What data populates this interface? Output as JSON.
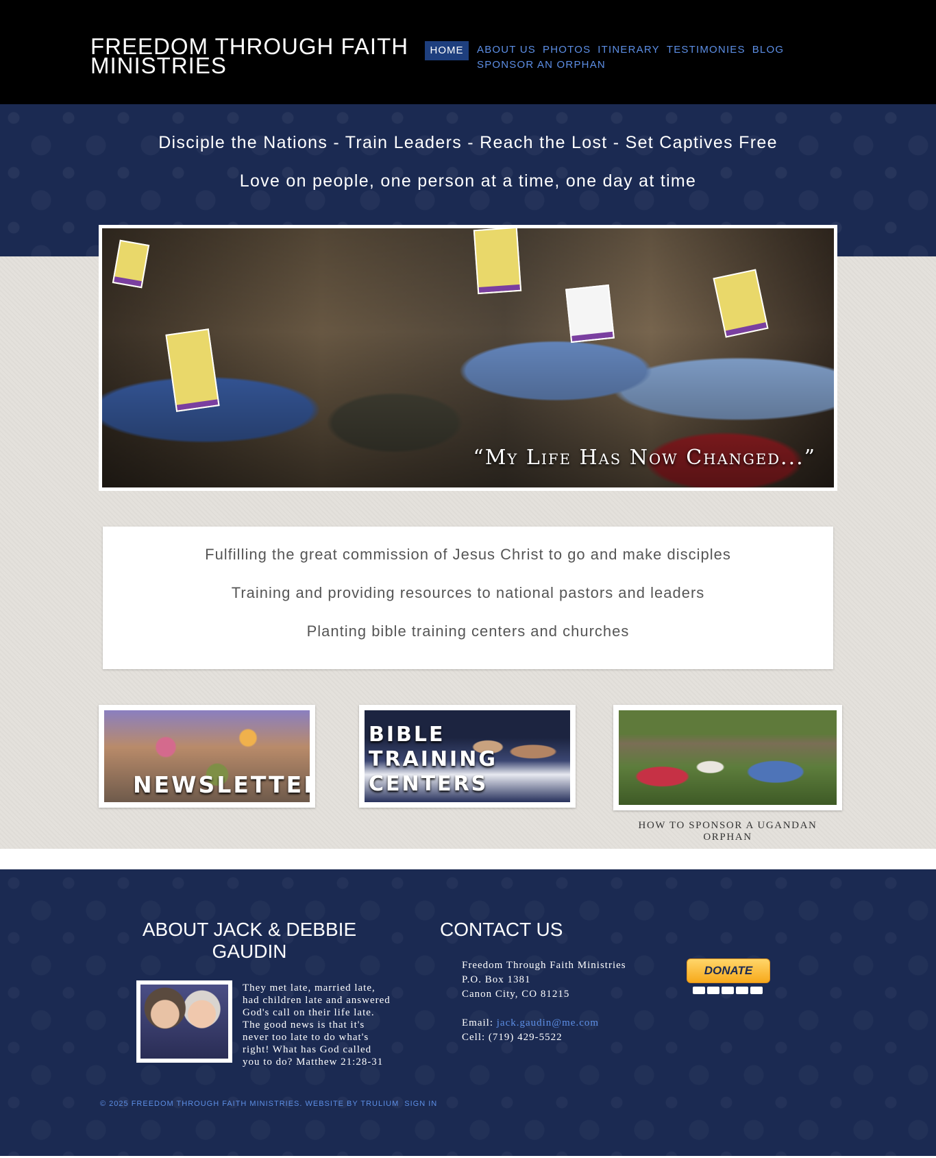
{
  "header": {
    "site_title": "FREEDOM THROUGH FAITH MINISTRIES",
    "nav": {
      "home": "HOME",
      "items": [
        "ABOUT US",
        "PHOTOS",
        "ITINERARY",
        "TESTIMONIES",
        "BLOG",
        "SPONSOR AN ORPHAN"
      ]
    }
  },
  "banner": {
    "tagline_1": "Disciple the Nations - Train Leaders - Reach the Lost - Set Captives Free",
    "tagline_2": "Love on people, one person at a time, one day at time"
  },
  "hero": {
    "caption": "“My Life Has Now Changed...”"
  },
  "mission": {
    "line_1": "Fulfilling the great commission of Jesus Christ to go and make disciples",
    "line_2": "Training and providing resources to national pastors and leaders",
    "line_3": "Planting bible training centers and churches"
  },
  "tiles": {
    "newsletters": "NEWSLETTERS",
    "bible_1": "BIBLE",
    "bible_2": "TRAINING",
    "bible_3": "CENTERS",
    "sponsor_caption": "HOW TO SPONSOR A UGANDAN ORPHAN"
  },
  "footer": {
    "about_heading": "ABOUT JACK & DEBBIE GAUDIN",
    "about_text": "They met late, married late, had children late and answered God's call on their life late.  The good news is that it's never too late to do what's right!  What has God called you to do?  Matthew 21:28-31",
    "contact_heading": "CONTACT US",
    "contact": {
      "org": "Freedom Through Faith Ministries",
      "po_box": "P.O. Box 1381",
      "city": "Canon City, CO  81215",
      "email_label": "Email: ",
      "email": "jack.gaudin@me.com",
      "cell": "Cell: (719) 429-5522"
    },
    "donate_label": "DONATE",
    "copyright": "© 2025 FREEDOM THROUGH FAITH MINISTRIES. WEBSITE BY TRULIUM",
    "sign_in": "SIGN IN"
  },
  "colors": {
    "header_bg": "#000000",
    "navy": "#1b2a52",
    "nav_link": "#5d8fe6",
    "home_active": "#1e3f7e"
  }
}
